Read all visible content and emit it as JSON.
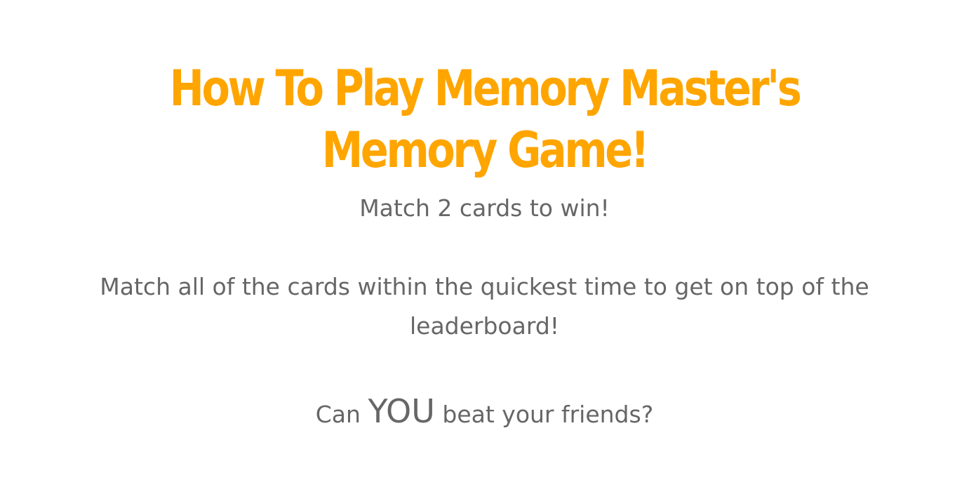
{
  "page": {
    "title": "How To Play Memory Master's Memory Game!",
    "instruction_1": "Match 2 cards to win!",
    "instruction_2": "Match all of the cards within the quickest time to get on top of the leaderboard!",
    "challenge": {
      "before": "Can ",
      "emphasis": "YOU",
      "after": " beat your friends?"
    }
  },
  "colors": {
    "title": "#ffa500",
    "text": "#666666",
    "background": "#ffffff"
  }
}
